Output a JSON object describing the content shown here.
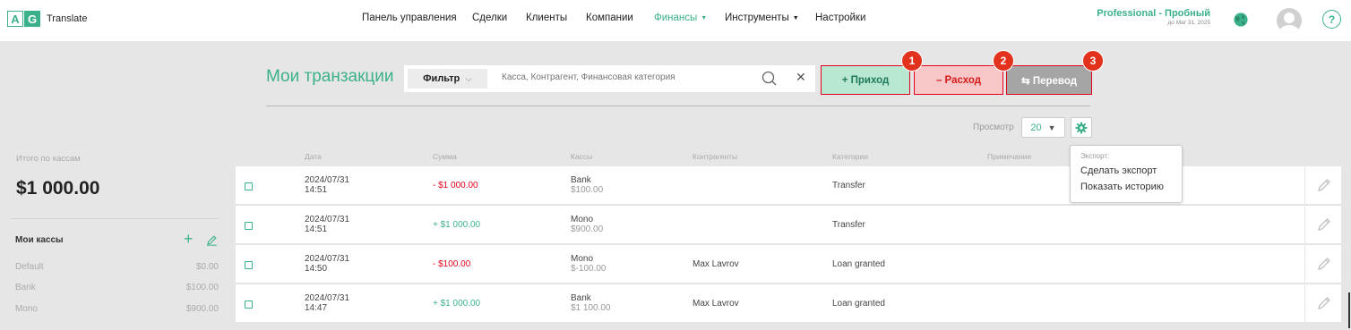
{
  "app": {
    "logo_a": "A",
    "logo_g": "G",
    "name": "Translate"
  },
  "nav": [
    {
      "label": "Панель управления",
      "dropdown": false
    },
    {
      "label": "Сделки",
      "dropdown": false
    },
    {
      "label": "Клиенты",
      "dropdown": false
    },
    {
      "label": "Компании",
      "dropdown": false
    },
    {
      "label": "Финансы",
      "dropdown": true,
      "active": true
    },
    {
      "label": "Инструменты",
      "dropdown": true
    },
    {
      "label": "Настройки",
      "dropdown": false
    }
  ],
  "plan": {
    "title": "Professional - Пробный",
    "until": "до Mar 31, 2025"
  },
  "help_label": "?",
  "page_title": "Мои транзакции",
  "filter": {
    "button_label": "Фильтр",
    "search_placeholder": "Касса, Контрагент, Финансовая категория"
  },
  "actions": {
    "income_label": "+ Приход",
    "expense_label": "– Расход",
    "transfer_label": "⇆ Перевод"
  },
  "badges": [
    "1",
    "2",
    "3"
  ],
  "pagination": {
    "label": "Просмотр",
    "per_page": "20"
  },
  "export_menu": {
    "header": "Экспорт:",
    "items": [
      "Сделать экспорт",
      "Показать историю"
    ]
  },
  "sidebar": {
    "total_label": "Итого по кассам",
    "total_value": "$1 000.00",
    "my_kassy": "Мои кассы",
    "kassy": [
      {
        "name": "Default",
        "value": "$0.00"
      },
      {
        "name": "Bank",
        "value": "$100.00"
      },
      {
        "name": "Mono",
        "value": "$900.00"
      }
    ]
  },
  "table": {
    "columns": [
      "Дата",
      "Сумма",
      "Кассы",
      "Контрагенты",
      "Категории",
      "Примечание"
    ],
    "rows": [
      {
        "date": "2024/07/31",
        "time": "14:51",
        "amount": "- $1 000.00",
        "sign": "neg",
        "kassa": "Bank",
        "kassa_balance": "$100.00",
        "contractor": "",
        "category": "Transfer",
        "note": ""
      },
      {
        "date": "2024/07/31",
        "time": "14:51",
        "amount": "+ $1 000.00",
        "sign": "pos",
        "kassa": "Mono",
        "kassa_balance": "$900.00",
        "contractor": "",
        "category": "Transfer",
        "note": ""
      },
      {
        "date": "2024/07/31",
        "time": "14:50",
        "amount": "- $100.00",
        "sign": "neg",
        "kassa": "Mono",
        "kassa_balance": "$-100.00",
        "contractor": "Max Lavrov",
        "category": "Loan granted",
        "note": ""
      },
      {
        "date": "2024/07/31",
        "time": "14:47",
        "amount": "+ $1 000.00",
        "sign": "pos",
        "kassa": "Bank",
        "kassa_balance": "$1 100.00",
        "contractor": "Max Lavrov",
        "category": "Loan granted",
        "note": ""
      }
    ]
  },
  "colors": {
    "accent": "#3bb18b",
    "negative": "#e2001a",
    "highlight_border": "#e2001a",
    "badge": "#e2321e"
  }
}
